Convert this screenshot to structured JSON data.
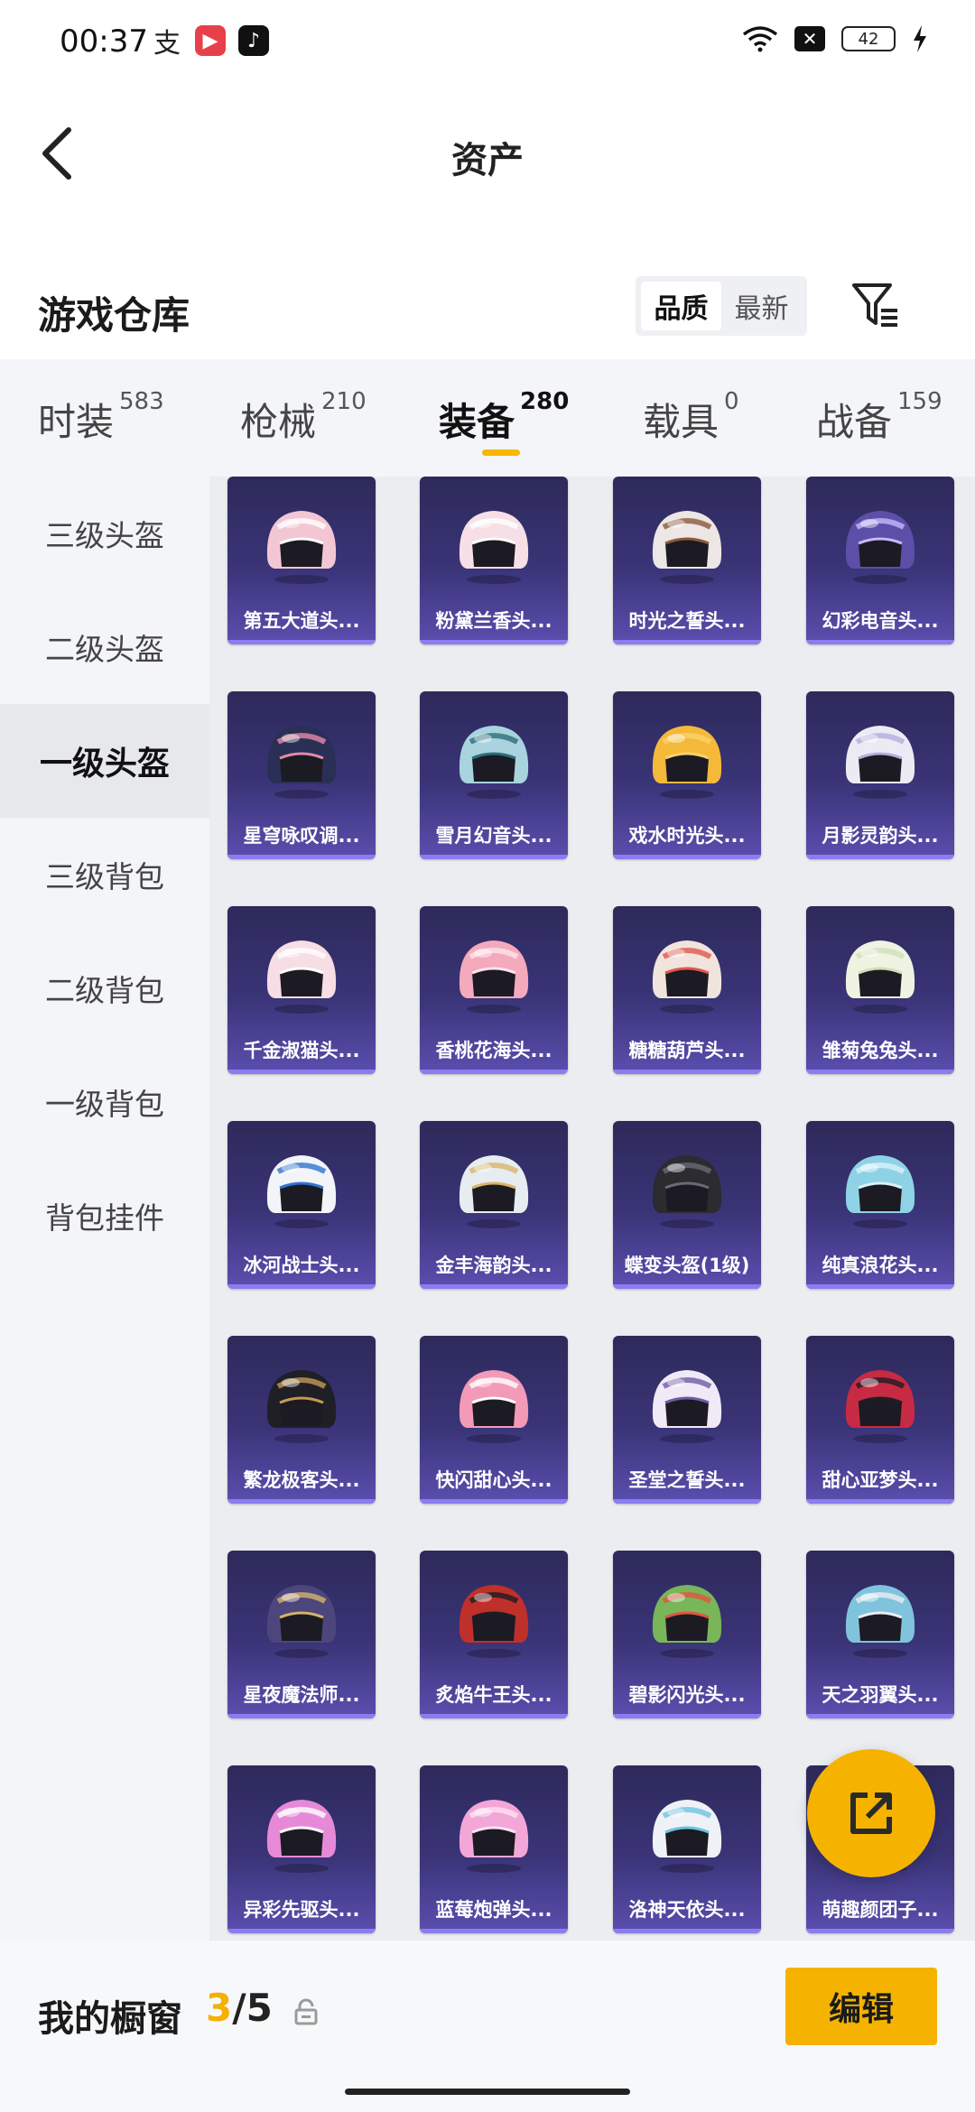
{
  "status_bar": {
    "time": "00:37",
    "apps": [
      {
        "name": "alipay-icon",
        "glyph": "支"
      },
      {
        "name": "video-app-icon",
        "glyph": "▶"
      },
      {
        "name": "tiktok-icon",
        "glyph": "♪"
      }
    ],
    "battery": "42"
  },
  "header": {
    "title": "资产"
  },
  "section": {
    "title": "游戏仓库",
    "sort_options": [
      "品质",
      "最新"
    ],
    "active_sort": "品质"
  },
  "tabs": [
    {
      "label": "时装",
      "count": "583"
    },
    {
      "label": "枪械",
      "count": "210"
    },
    {
      "label": "装备",
      "count": "280"
    },
    {
      "label": "载具",
      "count": "0"
    },
    {
      "label": "战备",
      "count": "159"
    }
  ],
  "active_tab": "装备",
  "side_menu": [
    {
      "label": "三级头盔"
    },
    {
      "label": "二级头盔"
    },
    {
      "label": "一级头盔"
    },
    {
      "label": "三级背包"
    },
    {
      "label": "二级背包"
    },
    {
      "label": "一级背包"
    },
    {
      "label": "背包挂件"
    }
  ],
  "active_side": "一级头盔",
  "items": [
    {
      "name": "第五大道头...",
      "color": "#f2c7d3",
      "accent": "#ffffff"
    },
    {
      "name": "粉黛兰香头...",
      "color": "#f6dfe6",
      "accent": "#ffffff"
    },
    {
      "name": "时光之誓头...",
      "color": "#ece6e4",
      "accent": "#8b5a3c"
    },
    {
      "name": "幻彩电音头...",
      "color": "#5b4fa8",
      "accent": "#c8b8ff"
    },
    {
      "name": "星穹咏叹调...",
      "color": "#2a2f55",
      "accent": "#e28aa8"
    },
    {
      "name": "雪月幻音头...",
      "color": "#a9d3de",
      "accent": "#2d6f7a"
    },
    {
      "name": "戏水时光头...",
      "color": "#f5b93a",
      "accent": "#f7d36a"
    },
    {
      "name": "月影灵韵头...",
      "color": "#ecebf4",
      "accent": "#b4aee0"
    },
    {
      "name": "千金淑猫头...",
      "color": "#f7dde4",
      "accent": "#ffffff"
    },
    {
      "name": "香桃花海头...",
      "color": "#f4a9bd",
      "accent": "#ffe3ea"
    },
    {
      "name": "糖糖葫芦头...",
      "color": "#f1e4dc",
      "accent": "#e0584e"
    },
    {
      "name": "雏菊兔兔头...",
      "color": "#eef3e2",
      "accent": "#cfe0bc"
    },
    {
      "name": "冰河战士头...",
      "color": "#f2f4f8",
      "accent": "#2f74d0"
    },
    {
      "name": "金丰海韵头...",
      "color": "#e6ecf0",
      "accent": "#d9b56a"
    },
    {
      "name": "蝶变头盔(1级)",
      "color": "#2b2b30",
      "accent": "#6a6a74"
    },
    {
      "name": "纯真浪花头...",
      "color": "#8fd2e6",
      "accent": "#d8f3fb"
    },
    {
      "name": "繁龙极客头...",
      "color": "#1f1f26",
      "accent": "#c39a55"
    },
    {
      "name": "快闪甜心头...",
      "color": "#f29ab7",
      "accent": "#ffffff"
    },
    {
      "name": "圣堂之誓头...",
      "color": "#efeaf6",
      "accent": "#6f5aa6"
    },
    {
      "name": "甜心亚梦头...",
      "color": "#c72a43",
      "accent": "#1e1e24"
    },
    {
      "name": "星夜魔法师...",
      "color": "#4d467c",
      "accent": "#d3b26a"
    },
    {
      "name": "炙焰牛王头...",
      "color": "#c0302a",
      "accent": "#1d1d22"
    },
    {
      "name": "碧影闪光头...",
      "color": "#79b65a",
      "accent": "#e2553d"
    },
    {
      "name": "天之羽翼头...",
      "color": "#7fc3dc",
      "accent": "#e9edf5"
    },
    {
      "name": "异彩先驱头...",
      "color": "#e68ad8",
      "accent": "#ffffff"
    },
    {
      "name": "蓝莓炮弹头...",
      "color": "#f3a6d8",
      "accent": "#ffe1f3"
    },
    {
      "name": "洛神天依头...",
      "color": "#eef2f7",
      "accent": "#6cc3e0"
    },
    {
      "name": "萌趣颜团子...",
      "color": "#f3e2d8",
      "accent": "#f1b7a0"
    }
  ],
  "bottom": {
    "showcase_label": "我的橱窗",
    "current": "3",
    "total": "/5",
    "edit_label": "编辑"
  },
  "colors": {
    "accent": "#f5b300",
    "card_bg": "#3a3478"
  }
}
